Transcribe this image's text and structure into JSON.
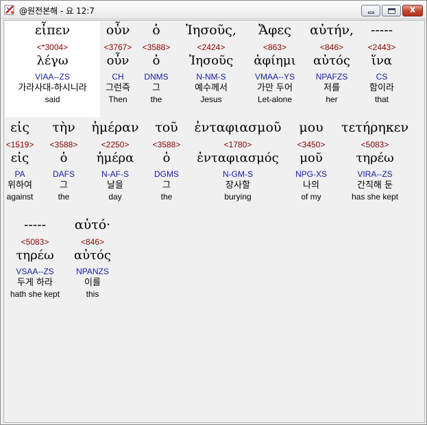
{
  "window": {
    "title": "@원전본해 - 요 12:7",
    "minimize_label": "",
    "maximize_label": "",
    "close_label": "x"
  },
  "words": [
    {
      "greek": "εἶπεν",
      "strong": "<*3004>",
      "lemma": "λέγω",
      "morph": "VIAA--ZS",
      "korean": "가라사대-하시니라",
      "english": "said"
    },
    {
      "greek": "οὖν",
      "strong": "<3767>",
      "lemma": "οὖν",
      "morph": "CH",
      "korean": "그런즉",
      "english": "Then"
    },
    {
      "greek": "ὁ",
      "strong": "<3588>",
      "lemma": "ὁ",
      "morph": "DNMS",
      "korean": "그",
      "english": "the"
    },
    {
      "greek": "Ἰησοῦς,",
      "strong": "<2424>",
      "lemma": "Ἰησοῦς",
      "morph": "N-NM-S",
      "korean": "예수께서",
      "english": "Jesus"
    },
    {
      "greek": "Ἄφες",
      "strong": "<863>",
      "lemma": "ἀφίημι",
      "morph": "VMAA--YS",
      "korean": "가만 두어",
      "english": "Let-alone"
    },
    {
      "greek": "αὐτήν,",
      "strong": "<846>",
      "lemma": "αὐτός",
      "morph": "NPAFZS",
      "korean": "저를",
      "english": "her"
    },
    {
      "greek": "-----",
      "strong": "<2443>",
      "lemma": "ἵνα",
      "morph": "CS",
      "korean": "함이라",
      "english": "that"
    },
    {
      "greek": "εἰς",
      "strong": "<1519>",
      "lemma": "εἰς",
      "morph": "PA",
      "korean": "위하여",
      "english": "against"
    },
    {
      "greek": "τὴν",
      "strong": "<3588>",
      "lemma": "ὁ",
      "morph": "DAFS",
      "korean": "그",
      "english": "the"
    },
    {
      "greek": "ἡμέραν",
      "strong": "<2250>",
      "lemma": "ἡμέρα",
      "morph": "N-AF-S",
      "korean": "날을",
      "english": "day"
    },
    {
      "greek": "τοῦ",
      "strong": "<3588>",
      "lemma": "ὁ",
      "morph": "DGMS",
      "korean": "그",
      "english": "the"
    },
    {
      "greek": "ἐνταφιασμοῦ",
      "strong": "<1780>",
      "lemma": "ἐνταφιασμός",
      "morph": "N-GM-S",
      "korean": "장사할",
      "english": "burying"
    },
    {
      "greek": "μου",
      "strong": "<3450>",
      "lemma": "μοῦ",
      "morph": "NPG-XS",
      "korean": "나의",
      "english": "of my"
    },
    {
      "greek": "τετήρηκεν",
      "strong": "<5083>",
      "lemma": "τηρέω",
      "morph": "VIRA--ZS",
      "korean": "간직해 둔",
      "english": "has she kept"
    },
    {
      "greek": "-----",
      "strong": "<5083>",
      "lemma": "τηρέω",
      "morph": "VSAA--ZS",
      "korean": "두게 하라",
      "english": "hath she kept"
    },
    {
      "greek": "αὐτό·",
      "strong": "<846>",
      "lemma": "αὐτός",
      "morph": "NPANZS",
      "korean": "이를",
      "english": "this"
    }
  ]
}
